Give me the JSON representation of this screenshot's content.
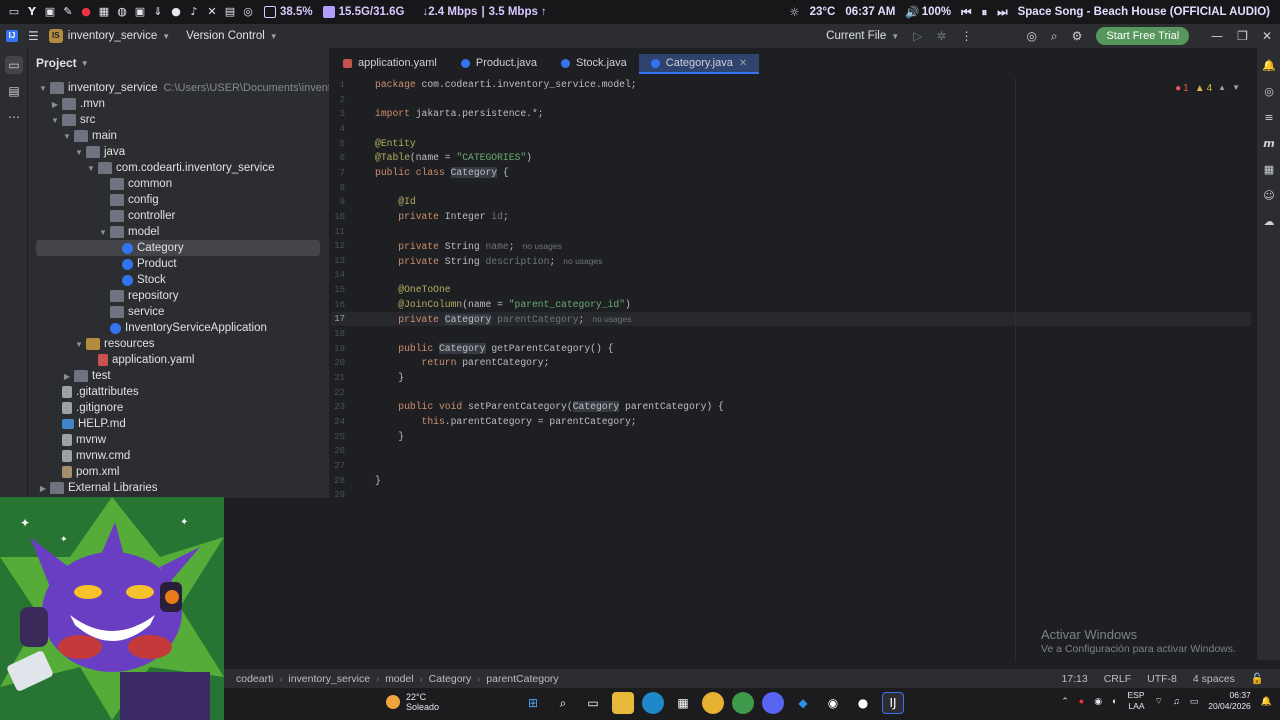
{
  "system_bar": {
    "cpu": "38.5%",
    "ram": "15.5G/31.6G",
    "down": "↓2.4 Mbps",
    "up": "3.5 Mbps ↑",
    "separator": "|",
    "weather": "23°C",
    "time": "06:37 AM",
    "volume": "100%",
    "media_title": "Space Song - Beach House (OFFICIAL AUDIO)"
  },
  "title_bar": {
    "project_badge": "IS",
    "project_name": "inventory_service",
    "vcs": "Version Control",
    "run_config": "Current File",
    "trial_button": "Start Free Trial"
  },
  "project_panel": {
    "title": "Project",
    "tree": [
      {
        "label": "inventory_service",
        "path": "C:\\Users\\USER\\Documents\\inventory_service",
        "type": "folder",
        "open": true
      },
      {
        "label": ".mvn",
        "type": "folder",
        "open": false
      },
      {
        "label": "src",
        "type": "folder",
        "open": true
      },
      {
        "label": "main",
        "type": "folder",
        "open": true
      },
      {
        "label": "java",
        "type": "folder",
        "open": true
      },
      {
        "label": "com.codearti.inventory_service",
        "type": "folder",
        "open": true
      },
      {
        "label": "common",
        "type": "folder"
      },
      {
        "label": "config",
        "type": "folder"
      },
      {
        "label": "controller",
        "type": "folder"
      },
      {
        "label": "model",
        "type": "folder",
        "open": true
      },
      {
        "label": "Category",
        "type": "class",
        "selected": true
      },
      {
        "label": "Product",
        "type": "class"
      },
      {
        "label": "Stock",
        "type": "class"
      },
      {
        "label": "repository",
        "type": "folder"
      },
      {
        "label": "service",
        "type": "folder"
      },
      {
        "label": "InventoryServiceApplication",
        "type": "class"
      },
      {
        "label": "resources",
        "type": "res",
        "open": true
      },
      {
        "label": "application.yaml",
        "type": "yaml"
      },
      {
        "label": "test",
        "type": "folder",
        "open": false
      },
      {
        "label": ".gitattributes",
        "type": "file"
      },
      {
        "label": ".gitignore",
        "type": "file"
      },
      {
        "label": "HELP.md",
        "type": "md"
      },
      {
        "label": "mvnw",
        "type": "file"
      },
      {
        "label": "mvnw.cmd",
        "type": "file"
      },
      {
        "label": "pom.xml",
        "type": "mvn"
      },
      {
        "label": "External Libraries",
        "type": "lib",
        "open": false
      }
    ]
  },
  "editor": {
    "tabs": [
      {
        "label": "application.yaml",
        "icon": "yaml"
      },
      {
        "label": "Product.java",
        "icon": "class"
      },
      {
        "label": "Stock.java",
        "icon": "class"
      },
      {
        "label": "Category.java",
        "icon": "class",
        "active": true
      }
    ],
    "errors": "1",
    "warnings": "4",
    "current_line": 17,
    "lines": [
      {
        "n": "1",
        "html": "<span class='kw'>package</span> com.codearti.inventory_service.model;"
      },
      {
        "n": "2",
        "html": ""
      },
      {
        "n": "3",
        "html": "<span class='kw'>import</span> jakarta.persistence.*;"
      },
      {
        "n": "4",
        "html": ""
      },
      {
        "n": "5",
        "html": "<span class='ann'>@Entity</span>"
      },
      {
        "n": "6",
        "html": "<span class='ann'>@Table</span>(name = <span class='str'>\"CATEGORIES\"</span>)"
      },
      {
        "n": "7",
        "html": "<span class='kw'>public class</span> <span class='hl'>Category</span> {"
      },
      {
        "n": "8",
        "html": ""
      },
      {
        "n": "9",
        "html": "    <span class='ann'>@Id</span>"
      },
      {
        "n": "10",
        "html": "    <span class='kw'>private</span> Integer <span class='unused'>id</span>;"
      },
      {
        "n": "11",
        "html": ""
      },
      {
        "n": "12",
        "html": "    <span class='kw'>private</span> String <span class='unused'>name</span>;<span class='hint'>no usages</span>"
      },
      {
        "n": "13",
        "html": "    <span class='kw'>private</span> String <span class='unused'>description</span>;<span class='hint'>no usages</span>"
      },
      {
        "n": "14",
        "html": ""
      },
      {
        "n": "15",
        "html": "    <span class='ann'>@OneToOne</span>"
      },
      {
        "n": "16",
        "html": "    <span class='ann'>@JoinColumn</span>(name = <span class='str'>\"parent_category_id\"</span>)"
      },
      {
        "n": "17",
        "html": "    <span class='kw'>private</span> <span class='hl'>Category</span> <span class='unused'>parentCategory</span>;<span class='hint'>no usages</span>"
      },
      {
        "n": "18",
        "html": ""
      },
      {
        "n": "19",
        "html": "    <span class='kw'>public</span> <span class='hl'>Category</span> getParentCategory() {"
      },
      {
        "n": "20",
        "html": "        <span class='kw'>return</span> parentCategory;"
      },
      {
        "n": "21",
        "html": "    }"
      },
      {
        "n": "22",
        "html": ""
      },
      {
        "n": "23",
        "html": "    <span class='kw'>public void</span> setParentCategory(<span class='hl'>Category</span> parentCategory) {"
      },
      {
        "n": "24",
        "html": "        <span class='kw'>this</span>.parentCategory = parentCategory;"
      },
      {
        "n": "25",
        "html": "    }"
      },
      {
        "n": "26",
        "html": ""
      },
      {
        "n": "27",
        "html": ""
      },
      {
        "n": "28",
        "html": "}"
      },
      {
        "n": "29",
        "html": ""
      }
    ]
  },
  "watermark": {
    "title": "Activar Windows",
    "subtitle": "Ve a Configuración para activar Windows."
  },
  "status_bar": {
    "breadcrumbs": [
      "codearti",
      "inventory_service",
      "model",
      "Category",
      "parentCategory"
    ],
    "position": "17:13",
    "line_sep": "CRLF",
    "encoding": "UTF-8",
    "indent": "4 spaces"
  },
  "taskbar": {
    "temp": "22°C",
    "condition": "Soleado",
    "lang": "ESP",
    "lang2": "LAA",
    "time": "06:37",
    "date": "20/04/2026"
  },
  "colors": {
    "accent": "#3574f0",
    "trial_green": "#57965c",
    "keyword": "#cf8e6d",
    "annotation": "#b3ae60",
    "string": "#6aab73"
  }
}
